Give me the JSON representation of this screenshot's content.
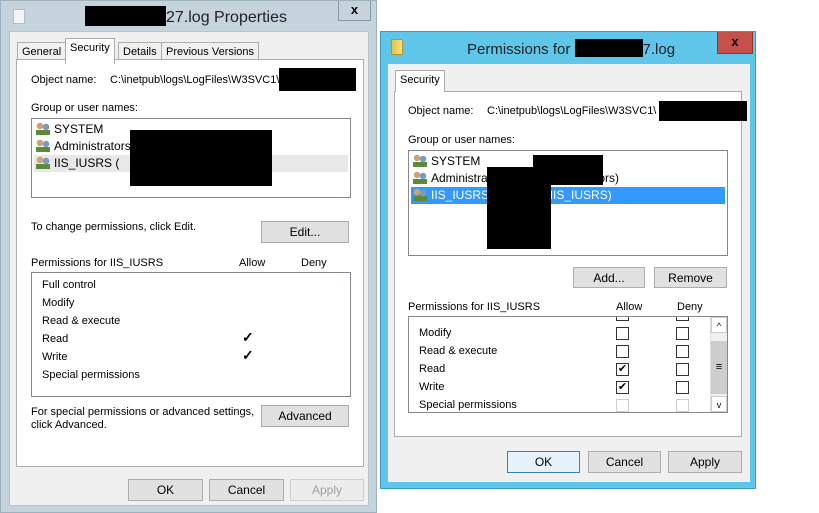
{
  "props": {
    "title_suffix": "27.log Properties",
    "close": "x",
    "tabs": [
      "General",
      "Security",
      "Details",
      "Previous Versions"
    ],
    "active_tab": "Security",
    "object_label": "Object name:",
    "object_value": "C:\\inetpub\\logs\\LogFiles\\W3SVC1\\",
    "group_label": "Group or user names:",
    "users": [
      "SYSTEM",
      "Administrators (",
      "IIS_IUSRS ("
    ],
    "user_tail": "s)",
    "selected_user": "IIS_IUSRS",
    "change_text": "To change permissions, click Edit.",
    "edit": "Edit...",
    "perm_header": "Permissions for IIS_IUSRS",
    "allow": "Allow",
    "deny": "Deny",
    "perms": [
      {
        "name": "Full control",
        "allow": false
      },
      {
        "name": "Modify",
        "allow": false
      },
      {
        "name": "Read & execute",
        "allow": false
      },
      {
        "name": "Read",
        "allow": true
      },
      {
        "name": "Write",
        "allow": true
      },
      {
        "name": "Special permissions",
        "allow": false
      }
    ],
    "check": "✓",
    "advanced_text1": "For special permissions or advanced settings,",
    "advanced_text2": "click Advanced.",
    "advanced": "Advanced",
    "ok": "OK",
    "cancel": "Cancel",
    "apply": "Apply"
  },
  "perm_dialog": {
    "title_prefix": "Permissions for",
    "title_suffix": "7.log",
    "close": "x",
    "tab": "Security",
    "object_label": "Object name:",
    "object_value": "C:\\inetpub\\logs\\LogFiles\\W3SVC1\\",
    "group_label": "Group or user names:",
    "users": [
      "SYSTEM",
      "Administrators (",
      "IIS_IUSRS ("
    ],
    "user_tails": [
      "",
      "strators)",
      "\\IIS_IUSRS)"
    ],
    "add": "Add...",
    "remove": "Remove",
    "perm_header": "Permissions for IIS_IUSRS",
    "allow": "Allow",
    "deny": "Deny",
    "perms": [
      {
        "name": "Modify",
        "allow": false,
        "deny": false
      },
      {
        "name": "Read & execute",
        "allow": false,
        "deny": false
      },
      {
        "name": "Read",
        "allow": true,
        "deny": false
      },
      {
        "name": "Write",
        "allow": true,
        "deny": false
      },
      {
        "name": "Special permissions",
        "allow": false,
        "deny": false,
        "disabled": true
      }
    ],
    "check": "✔",
    "scroll_up": "^",
    "scroll_down": "v",
    "scroll_grip": "≡",
    "ok": "OK",
    "cancel": "Cancel",
    "apply": "Apply",
    "frame_color": "#5fc6ea",
    "close_color": "#c7504b"
  }
}
